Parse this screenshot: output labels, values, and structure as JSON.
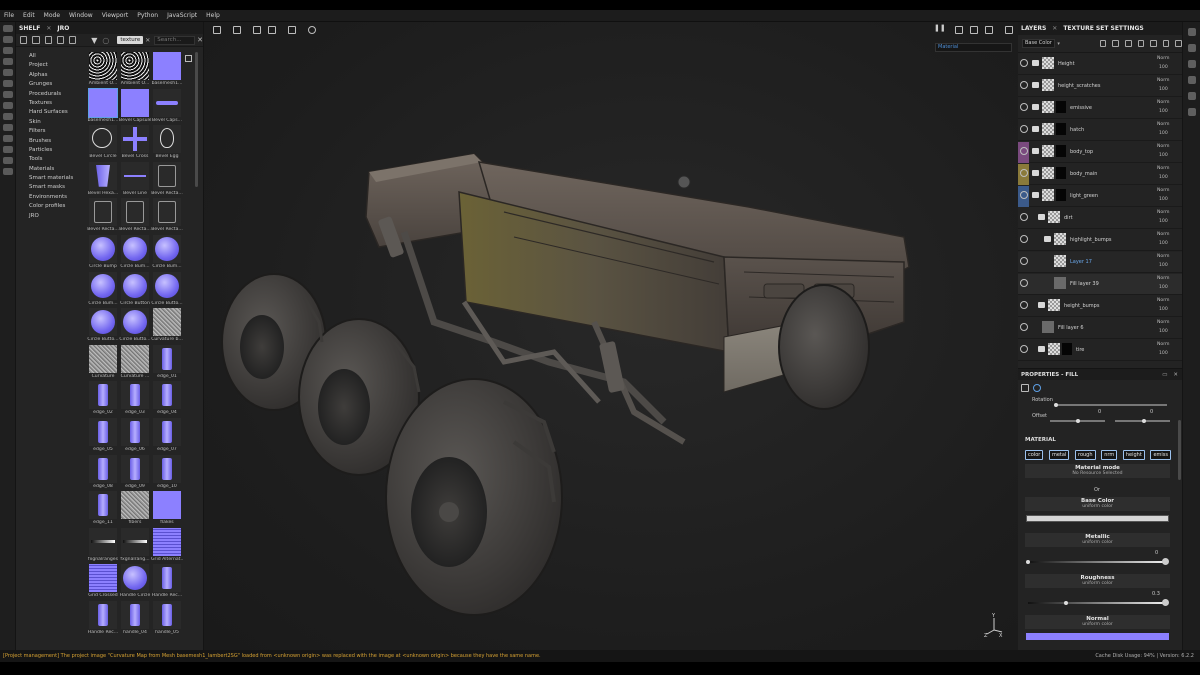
{
  "menu": [
    "File",
    "Edit",
    "Mode",
    "Window",
    "Viewport",
    "Python",
    "JavaScript",
    "Help"
  ],
  "shelf": {
    "tabs": [
      "SHELF",
      "JRO"
    ],
    "filter_chip": "texture",
    "search_placeholder": "Search...",
    "categories": [
      "All",
      "Project",
      "Alphas",
      "Grunges",
      "Procedurals",
      "Textures",
      "Hard Surfaces",
      "Skin",
      "Filters",
      "Brushes",
      "Particles",
      "Tools",
      "Materials",
      "Smart materials",
      "Smart masks",
      "Environments",
      "Color profiles",
      "JRO"
    ],
    "assets": [
      {
        "label": "Ambient O...",
        "kind": "noise"
      },
      {
        "label": "Ambient O...",
        "kind": "noise"
      },
      {
        "label": "basemesh1...",
        "kind": "normal"
      },
      {
        "label": "basemesh1...",
        "kind": "normal"
      },
      {
        "label": "Bevel Capsule",
        "kind": "normal"
      },
      {
        "label": "Bevel Caps...",
        "kind": "capsule"
      },
      {
        "label": "Bevel Circle",
        "kind": "circle-outline"
      },
      {
        "label": "Bevel Cross",
        "kind": "cross"
      },
      {
        "label": "Bevel Egg",
        "kind": "egg"
      },
      {
        "label": "Bevel Hexa...",
        "kind": "hexa"
      },
      {
        "label": "Bevel Line",
        "kind": "line"
      },
      {
        "label": "Bevel Recta...",
        "kind": "rect-outline"
      },
      {
        "label": "Bevel Recta...",
        "kind": "rect-outline"
      },
      {
        "label": "Bevel Recta...",
        "kind": "rect-outline"
      },
      {
        "label": "Bevel Recta...",
        "kind": "rect-outline"
      },
      {
        "label": "Circle Bump",
        "kind": "bump"
      },
      {
        "label": "Circle Bum...",
        "kind": "bump"
      },
      {
        "label": "Circle Bum...",
        "kind": "bump"
      },
      {
        "label": "Circle Bum...",
        "kind": "bump"
      },
      {
        "label": "Circle Button",
        "kind": "bump"
      },
      {
        "label": "Circle Butto...",
        "kind": "bump"
      },
      {
        "label": "Circle Butto...",
        "kind": "bump"
      },
      {
        "label": "Circle Butto...",
        "kind": "bump"
      },
      {
        "label": "Curvature b...",
        "kind": "noise-grey"
      },
      {
        "label": "Curvature",
        "kind": "noise-grey"
      },
      {
        "label": "Curvature ...",
        "kind": "noise-grey"
      },
      {
        "label": "edge_01",
        "kind": "edge"
      },
      {
        "label": "edge_02",
        "kind": "edge"
      },
      {
        "label": "edge_03",
        "kind": "edge"
      },
      {
        "label": "edge_04",
        "kind": "edge"
      },
      {
        "label": "edge_05",
        "kind": "edge"
      },
      {
        "label": "edge_06",
        "kind": "edge"
      },
      {
        "label": "edge_07",
        "kind": "edge"
      },
      {
        "label": "edge_08",
        "kind": "edge"
      },
      {
        "label": "edge_09",
        "kind": "edge"
      },
      {
        "label": "edge_10",
        "kind": "edge"
      },
      {
        "label": "edge_11",
        "kind": "edge"
      },
      {
        "label": "fibers",
        "kind": "noise-grey"
      },
      {
        "label": "flakes",
        "kind": "normal"
      },
      {
        "label": "fxgnalranges",
        "kind": "gradient"
      },
      {
        "label": "fxgnalrang...",
        "kind": "gradient"
      },
      {
        "label": "Grid Alternat...",
        "kind": "grid"
      },
      {
        "label": "Grid Crossed",
        "kind": "grid"
      },
      {
        "label": "Handle Circle",
        "kind": "bump"
      },
      {
        "label": "Handle Rec...",
        "kind": "edge"
      },
      {
        "label": "Handle Rec...",
        "kind": "edge"
      },
      {
        "label": "handle_04",
        "kind": "edge"
      },
      {
        "label": "handle_05",
        "kind": "edge"
      }
    ]
  },
  "viewport": {
    "material_mode": "Material"
  },
  "layers_panel": {
    "tabs": [
      "LAYERS",
      "TEXTURE SET SETTINGS"
    ],
    "channel": "Base Color",
    "rows": [
      {
        "name": "Height",
        "blend": "Norm",
        "opacity": "100",
        "indent": 0,
        "type": "folder",
        "tag": ""
      },
      {
        "name": "height_scratches",
        "blend": "Norm",
        "opacity": "100",
        "indent": 0,
        "type": "folder",
        "tag": ""
      },
      {
        "name": "emissive",
        "blend": "Norm",
        "opacity": "100",
        "indent": 0,
        "type": "folder",
        "tag": ""
      },
      {
        "name": "hatch",
        "blend": "Norm",
        "opacity": "100",
        "indent": 0,
        "type": "folder",
        "tag": ""
      },
      {
        "name": "body_top",
        "blend": "Norm",
        "opacity": "100",
        "indent": 0,
        "type": "folder",
        "tag": "#7a4a7e"
      },
      {
        "name": "body_main",
        "blend": "Norm",
        "opacity": "100",
        "indent": 0,
        "type": "folder",
        "tag": "#8a7a3a"
      },
      {
        "name": "light_green",
        "blend": "Norm",
        "opacity": "100",
        "indent": 0,
        "type": "folder",
        "tag": "#3b5a8a"
      },
      {
        "name": "dirt",
        "blend": "Norm",
        "opacity": "100",
        "indent": 1,
        "type": "folder",
        "tag": ""
      },
      {
        "name": "highlight_bumps",
        "blend": "Norm",
        "opacity": "100",
        "indent": 2,
        "type": "folder",
        "tag": ""
      },
      {
        "name": "Layer 17",
        "blend": "Norm",
        "opacity": "100",
        "indent": 3,
        "type": "layer",
        "tag": ""
      },
      {
        "name": "Fill layer 39",
        "blend": "Norm",
        "opacity": "100",
        "indent": 3,
        "type": "fill",
        "tag": ""
      },
      {
        "name": "height_bumps",
        "blend": "Norm",
        "opacity": "100",
        "indent": 1,
        "type": "folder",
        "tag": ""
      },
      {
        "name": "Fill layer 6",
        "blend": "Norm",
        "opacity": "100",
        "indent": 1,
        "type": "fill",
        "tag": ""
      },
      {
        "name": "tire",
        "blend": "Norm",
        "opacity": "100",
        "indent": 1,
        "type": "folder",
        "tag": ""
      }
    ]
  },
  "properties": {
    "title": "PROPERTIES - FILL",
    "rotation_label": "Rotation",
    "offset_label": "Offset",
    "offset_values": [
      "0",
      "0"
    ],
    "section": "MATERIAL",
    "channels": [
      "color",
      "metal",
      "rough",
      "nrm",
      "height",
      "emiss"
    ],
    "material_mode_title": "Material mode",
    "material_mode_sub": "No Resource Selected",
    "or_label": "Or",
    "base_color_title": "Base Color",
    "base_color_sub": "uniform color",
    "base_color_hex": "#d6d6d6",
    "metallic_title": "Metallic",
    "metallic_sub": "uniform color",
    "metallic_value": "0",
    "roughness_title": "Roughness",
    "roughness_sub": "uniform color",
    "roughness_value": "0.3",
    "normal_title": "Normal",
    "normal_sub": "uniform color",
    "normal_hex": "#8c80ff"
  },
  "status": {
    "message": "[Project management] The project image \"Curvature Map from Mesh basemesh1_lambert2SG\" loaded from <unknown origin> was replaced with the image at <unknown origin> because they have the same name.",
    "right": "Cache Disk Usage: 94% | Version: 6.2.2"
  },
  "colors": {
    "accent": "#4f8fd6",
    "normal_map": "#8c80ff",
    "status_warning": "#d6a233"
  }
}
